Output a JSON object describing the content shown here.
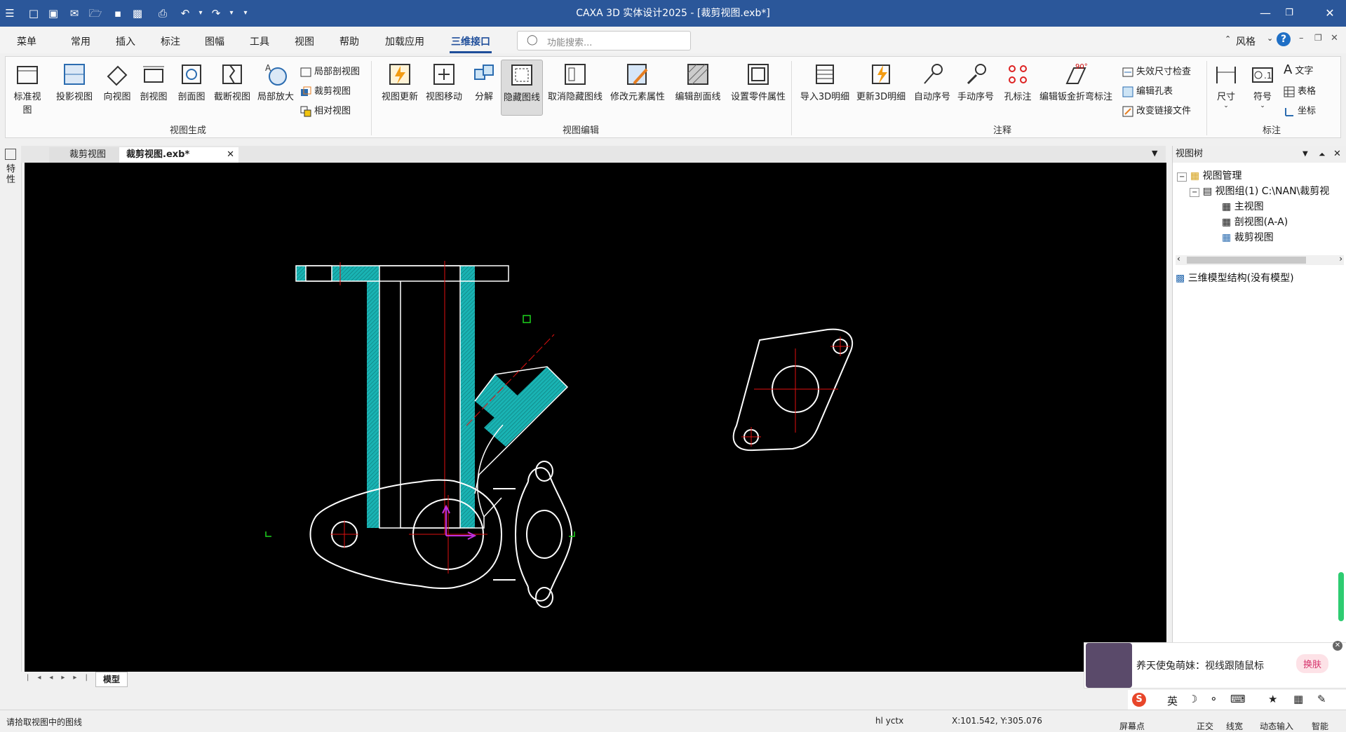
{
  "window": {
    "title": "CAXA 3D 实体设计2025 - [裁剪视图.exb*]"
  },
  "menus": [
    "菜单",
    "常用",
    "插入",
    "标注",
    "图幅",
    "工具",
    "视图",
    "帮助",
    "加载应用",
    "三维接口"
  ],
  "active_menu": "三维接口",
  "search": {
    "placeholder": "功能搜索..."
  },
  "style": {
    "label": "风格"
  },
  "ribbon": {
    "view_gen": {
      "buttons": [
        "标准视图",
        "投影视图",
        "向视图",
        "剖视图",
        "剖面图",
        "截断视图",
        "局部放大"
      ],
      "small": [
        "局部剖视图",
        "裁剪视图",
        "相对视图"
      ],
      "group": "视图生成"
    },
    "view_edit": {
      "buttons": [
        "视图更新",
        "视图移动",
        "分解",
        "隐藏图线",
        "取消隐藏图线",
        "修改元素属性",
        "编辑剖面线",
        "设置零件属性"
      ],
      "group": "视图编辑"
    },
    "annot": {
      "buttons": [
        "导入3D明细",
        "更新3D明细",
        "自动序号",
        "手动序号",
        "孔标注",
        "编辑钣金折弯标注"
      ],
      "small": [
        "失效尺寸检查",
        "编辑孔表",
        "改变链接文件"
      ],
      "group": "注释"
    },
    "dim": {
      "buttons": [
        "尺寸",
        "符号"
      ],
      "small": [
        "文字",
        "表格",
        "坐标"
      ],
      "group": "标注"
    }
  },
  "doc_tabs": [
    "裁剪视图",
    "裁剪视图.exb*"
  ],
  "model_tab": "模型",
  "side_label": "特性",
  "view_tree": {
    "title": "视图树",
    "root": "视图管理",
    "group": "视图组(1)  C:\\NAN\\裁剪视",
    "items": [
      "主视图",
      "剖视图(A-A)",
      "裁剪视图"
    ],
    "model": "三维模型结构(没有模型)"
  },
  "popup": {
    "text": "养天使兔萌妹：视线跟随鼠标",
    "btn": "换肤"
  },
  "status": {
    "prompt": "请拾取视图中的图线",
    "user": "hl yctx",
    "coords": "X:101.542, Y:305.076",
    "right": [
      "屏幕点",
      "正交",
      "线宽",
      "动态输入",
      "智能"
    ]
  },
  "ime": {
    "lang": "英"
  },
  "colors": {
    "title_bg": "#2b579a",
    "canvas": "#000000",
    "hatch": "#19b3b3",
    "center": "#e01010"
  },
  "icons": [
    "app-icon",
    "new-icon",
    "open-icon",
    "save-icon",
    "print-icon",
    "undo-icon",
    "redo-icon",
    "help-icon",
    "minimize-icon",
    "maximize-icon",
    "close-icon"
  ]
}
